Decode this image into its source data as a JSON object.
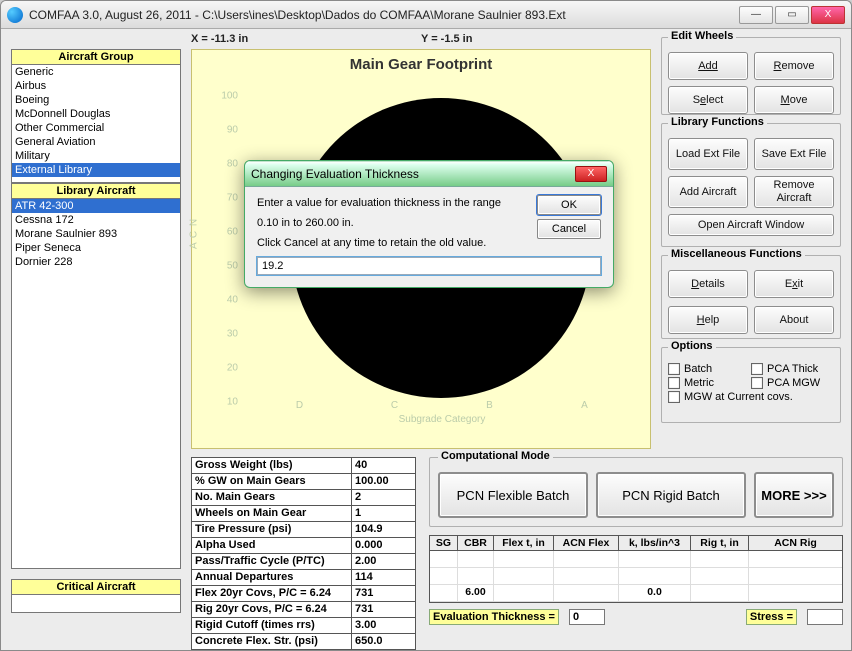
{
  "window": {
    "title": "COMFAA 3.0, August 26, 2011 - C:\\Users\\ines\\Desktop\\Dados do COMFAA\\Morane Saulnier 893.Ext",
    "min": "—",
    "max": "▭",
    "close": "X"
  },
  "coords": {
    "x": "X = -11.3 in",
    "y": "Y = -1.5 in"
  },
  "aircraft_group": {
    "header": "Aircraft Group",
    "items": [
      "Generic",
      "Airbus",
      "Boeing",
      "McDonnell Douglas",
      "Other Commercial",
      "General Aviation",
      "Military",
      "External Library"
    ],
    "selected": 7
  },
  "library_aircraft": {
    "header": "Library Aircraft",
    "items": [
      "ATR 42-300",
      "Cessna 172",
      "Morane Saulnier 893",
      "Piper Seneca",
      "Dornier 228"
    ],
    "selected": 0
  },
  "critical": {
    "header": "Critical Aircraft",
    "value": ""
  },
  "edit_wheels": {
    "legend": "Edit Wheels",
    "add": "Add",
    "remove": "Remove",
    "select": "Select",
    "move": "Move"
  },
  "library_functions": {
    "legend": "Library Functions",
    "load": "Load Ext File",
    "save": "Save Ext File",
    "adda": "Add Aircraft",
    "rema": "Remove Aircraft",
    "open": "Open Aircraft Window"
  },
  "misc": {
    "legend": "Miscellaneous Functions",
    "details": "Details",
    "exit": "Exit",
    "help": "Help",
    "about": "About"
  },
  "options": {
    "legend": "Options",
    "batch": "Batch",
    "pcathick": "PCA Thick",
    "metric": "Metric",
    "pcamgw": "PCA MGW",
    "mgwcur": "MGW at Current covs."
  },
  "chart": {
    "title": "Main Gear Footprint",
    "ylabel": "A C N",
    "yticks": [
      "100",
      "90",
      "80",
      "70",
      "60",
      "50",
      "40",
      "30",
      "20",
      "10"
    ],
    "xticks": [
      "D",
      "C",
      "B",
      "A"
    ],
    "xlabel": "Subgrade Category"
  },
  "props": [
    {
      "k": "Gross Weight (lbs)",
      "v": "40"
    },
    {
      "k": "% GW on Main Gears",
      "v": "100.00"
    },
    {
      "k": "No. Main Gears",
      "v": "2"
    },
    {
      "k": "Wheels on Main Gear",
      "v": "1"
    },
    {
      "k": "Tire Pressure (psi)",
      "v": "104.9"
    },
    {
      "k": "Alpha Used",
      "v": "0.000"
    },
    {
      "k": "Pass/Traffic Cycle (P/TC)",
      "v": "2.00"
    },
    {
      "k": "Annual Departures",
      "v": "114"
    },
    {
      "k": "Flex 20yr Covs, P/C = 6.24",
      "v": "731"
    },
    {
      "k": "Rig 20yr Covs,  P/C = 6.24",
      "v": "731"
    },
    {
      "k": "Rigid Cutoff (times rrs)",
      "v": "3.00"
    },
    {
      "k": "Concrete Flex. Str. (psi)",
      "v": "650.0"
    }
  ],
  "mode": {
    "legend": "Computational Mode",
    "flex": "PCN Flexible Batch",
    "rigid": "PCN Rigid Batch",
    "more": "MORE >>>"
  },
  "results": {
    "headers": [
      "SG",
      "CBR",
      "Flex t, in",
      "ACN Flex",
      "k, lbs/in^3",
      "Rig t, in",
      "ACN Rig"
    ],
    "row": {
      "sg": "",
      "cbr": "6.00",
      "flext": "",
      "acnf": "",
      "k": "0.0",
      "rigt": "",
      "acnr": ""
    }
  },
  "bottom": {
    "evalthk_l": "Evaluation Thickness =",
    "evalthk_v": "0",
    "stress_l": "Stress =",
    "stress_v": ""
  },
  "dialog": {
    "title": "Changing Evaluation Thickness",
    "line1": "Enter a value for evaluation thickness in the range",
    "line2": "0.10 in to 260.00 in.",
    "line3": "Click Cancel at any time to retain the old value.",
    "value": "19.2",
    "ok": "OK",
    "cancel": "Cancel"
  },
  "chart_data": {
    "type": "scatter",
    "title": "Main Gear Footprint",
    "xlabel": "Subgrade Category",
    "ylabel": "ACN",
    "categories": [
      "D",
      "C",
      "B",
      "A"
    ],
    "ylim": [
      0,
      100
    ],
    "series": [
      {
        "name": "footprint-ellipse",
        "note": "single wheel footprint rendered as filled circle; no numeric series visible"
      }
    ]
  }
}
